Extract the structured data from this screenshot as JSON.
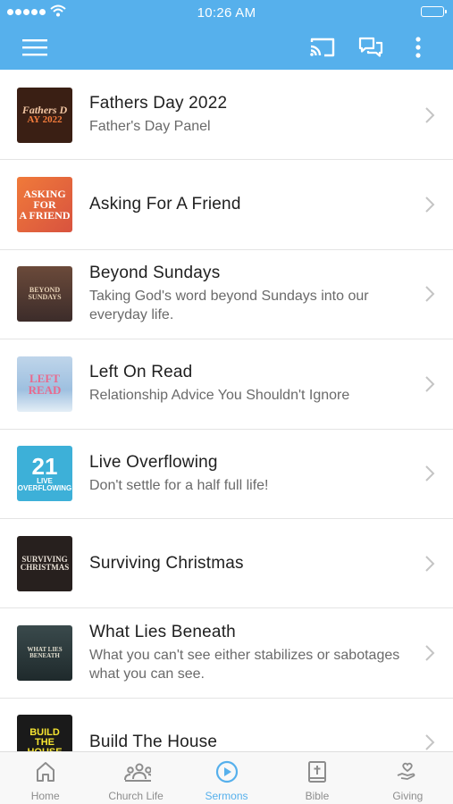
{
  "status_bar": {
    "time": "10:26 AM"
  },
  "header": {
    "menu_icon": "hamburger-icon",
    "cast_icon": "cast-icon",
    "chat_icon": "chat-icon",
    "more_icon": "more-vertical-icon"
  },
  "sermons": [
    {
      "title": "Fathers Day 2022",
      "subtitle": "Father's Day  Panel",
      "thumb_line1": "Fathers D",
      "thumb_line2": "AY 2022"
    },
    {
      "title": "Asking For A Friend",
      "subtitle": "",
      "thumb_line1": "ASKING FOR",
      "thumb_line2": "A FRIEND"
    },
    {
      "title": "Beyond Sundays",
      "subtitle": "Taking God's word beyond Sundays into our everyday life.",
      "thumb_line1": "BEYOND",
      "thumb_line2": "SUNDAYS"
    },
    {
      "title": "Left On Read",
      "subtitle": "Relationship Advice You Shouldn't Ignore",
      "thumb_line1": "LEFT",
      "thumb_line2": "READ"
    },
    {
      "title": "Live Overflowing",
      "subtitle": "Don't settle for a half full life!",
      "thumb_line1": "21",
      "thumb_line2": "LIVE OVERFLOWING"
    },
    {
      "title": "Surviving Christmas",
      "subtitle": "",
      "thumb_line1": "SURVIVING",
      "thumb_line2": "CHRISTMAS"
    },
    {
      "title": "What Lies Beneath",
      "subtitle": "What you can't see either stabilizes or sabotages what you can see.",
      "thumb_line1": "WHAT LIES",
      "thumb_line2": "BENEATH"
    },
    {
      "title": "Build The House",
      "subtitle": "",
      "thumb_line1": "BUILD",
      "thumb_line2": "THE HOUSE"
    }
  ],
  "tabs": [
    {
      "label": "Home",
      "icon": "home-icon",
      "active": false
    },
    {
      "label": "Church Life",
      "icon": "people-icon",
      "active": false
    },
    {
      "label": "Sermons",
      "icon": "play-circle-icon",
      "active": true
    },
    {
      "label": "Bible",
      "icon": "bible-icon",
      "active": false
    },
    {
      "label": "Giving",
      "icon": "giving-hand-icon",
      "active": false
    }
  ],
  "colors": {
    "accent": "#56b0ec",
    "tab_inactive": "#8d8d8d",
    "divider": "#e4e4e4"
  }
}
